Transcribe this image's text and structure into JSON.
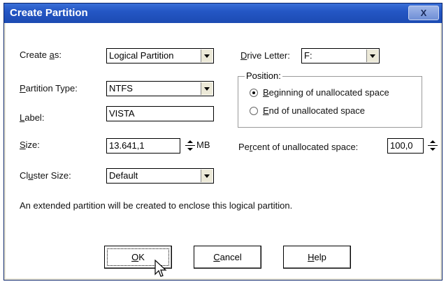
{
  "window": {
    "title": "Create Partition",
    "close_label": "X"
  },
  "create_as": {
    "label_pre": "Create ",
    "label_u": "a",
    "label_post": "s:",
    "value": "Logical Partition"
  },
  "partition_type": {
    "label_pre": "",
    "label_u": "P",
    "label_post": "artition Type:",
    "value": "NTFS"
  },
  "label_field": {
    "label_pre": "",
    "label_u": "L",
    "label_post": "abel:",
    "value": "VISTA"
  },
  "size": {
    "label_pre": "",
    "label_u": "S",
    "label_post": "ize:",
    "value": "13.641,1",
    "unit": "MB"
  },
  "cluster_size": {
    "label_pre": "Cl",
    "label_u": "u",
    "label_post": "ster Size:",
    "value": "Default"
  },
  "drive_letter": {
    "label_pre": "",
    "label_u": "D",
    "label_post": "rive Letter:",
    "value": "F:"
  },
  "position": {
    "group_label": "Position:",
    "option_beginning": {
      "pre": "",
      "u": "B",
      "post": "eginning of unallocated space",
      "selected": true
    },
    "option_end": {
      "pre": "",
      "u": "E",
      "post": "nd of unallocated space",
      "selected": false
    }
  },
  "percent": {
    "label_pre": "Pe",
    "label_u": "r",
    "label_post": "cent of unallocated space:",
    "value": "100,0"
  },
  "info_text": "An extended partition will be created to enclose this logical partition.",
  "buttons": {
    "ok": {
      "pre": "",
      "u": "O",
      "post": "K"
    },
    "cancel": {
      "pre": "",
      "u": "C",
      "post": "ancel"
    },
    "help": {
      "pre": "",
      "u": "H",
      "post": "elp"
    }
  }
}
